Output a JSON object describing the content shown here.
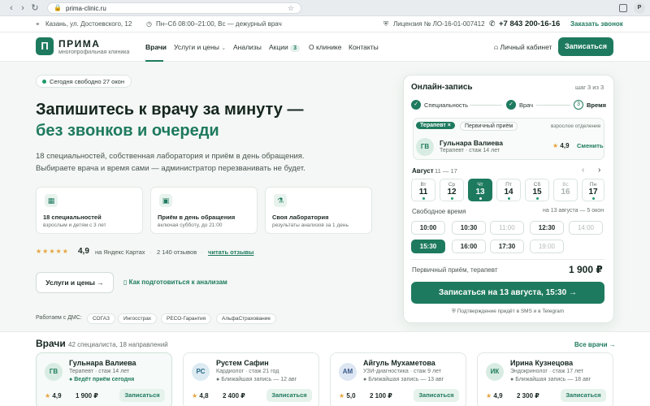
{
  "browser": {
    "url": "prima-clinic.ru",
    "profile": "P"
  },
  "utility": {
    "address": "Казань, ул. Достоевского, 12",
    "hours": "Пн–Сб 08:00–21:00, Вс — дежурный врач",
    "license": "Лицензия № ЛО-16-01-007412",
    "phone": "+7 843 200-16-16",
    "callback": "Заказать звонок"
  },
  "header": {
    "logo_letter": "П",
    "brand": "ПРИМА",
    "tagline": "многопрофильная клиника",
    "nav": {
      "doctors": "Врачи",
      "services": "Услуги и цены",
      "tests": "Анализы",
      "promos": "Акции",
      "promos_count": "3",
      "about": "О клинике",
      "contacts": "Контакты"
    },
    "account": "Личный кабинет",
    "signup": "Записаться"
  },
  "hero": {
    "pill": "Сегодня свободно 27 окон",
    "title_line1": "Запишитесь к врачу за минуту —",
    "title_line2": "без звонков и очереди",
    "lead_line1": "18 специальностей, собственная лаборатория и приём в день обращения.",
    "lead_line2": "Выбираете врача и время сами — администратор перезванивать не будет.",
    "features": [
      {
        "title": "18 специальностей",
        "sub": "взрослым и детям с 3 лет",
        "icon": "grid-icon"
      },
      {
        "title": "Приём в день обращения",
        "sub": "включая субботу, до 21:00",
        "icon": "calendar-icon"
      },
      {
        "title": "Своя лаборатория",
        "sub": "результаты анализов за 1 день",
        "icon": "flask-icon"
      }
    ],
    "rating": "4,9",
    "rating_value": 4.9,
    "rating_source": "на Яндекс Картах",
    "reviews_count": "2 140 отзывов",
    "reviews_link": "читать отзывы",
    "services_btn": "Услуги и цены",
    "prep_link": "Как подготовиться к анализам",
    "dms_label": "Работаем с ДМС:",
    "insurers": [
      "СОГАЗ",
      "Ингосстрах",
      "РЕСО-Гарантия",
      "АльфаСтрахование"
    ]
  },
  "booking": {
    "title": "Онлайн-запись",
    "step_info": "шаг 3 из 3",
    "steps": [
      "Специальность",
      "Врач",
      "Время"
    ],
    "current_step_number": "3",
    "specialty_selected": "Терапевт",
    "visit_type": "Первичный приём",
    "department": "взрослое отделение",
    "doctor": {
      "initials": "ГВ",
      "name": "Гульнара Валиева",
      "meta": "Терапевт · стаж 14 лет",
      "rating": "4,9",
      "change": "Сменить"
    },
    "month": "Август",
    "range": "11 — 17",
    "days": [
      {
        "dow": "Вт",
        "num": "11",
        "free": true
      },
      {
        "dow": "Ср",
        "num": "12",
        "free": true
      },
      {
        "dow": "Чт",
        "num": "13",
        "free": true,
        "selected": true
      },
      {
        "dow": "Пт",
        "num": "14",
        "free": true
      },
      {
        "dow": "Сб",
        "num": "15",
        "free": true
      },
      {
        "dow": "Вс",
        "num": "16",
        "free": false
      },
      {
        "dow": "Пн",
        "num": "17",
        "free": true
      }
    ],
    "free_time_label": "Свободное время",
    "date_label": "на 13 августа — 5 окон",
    "slots": [
      {
        "t": "10:00",
        "state": "free"
      },
      {
        "t": "10:30",
        "state": "free"
      },
      {
        "t": "11:00",
        "state": "busy"
      },
      {
        "t": "12:30",
        "state": "free"
      },
      {
        "t": "14:00",
        "state": "busy"
      },
      {
        "t": "15:30",
        "state": "selected"
      },
      {
        "t": "16:00",
        "state": "free"
      },
      {
        "t": "17:30",
        "state": "free"
      },
      {
        "t": "19:00",
        "state": "busy"
      }
    ],
    "price_label": "Первичный приём, терапевт",
    "price": "1 900 ₽",
    "confirm_btn": "Записаться на 13 августа, 15:30",
    "sms_note": "Подтверждение придёт в SMS и в Telegram"
  },
  "doctors_section": {
    "title": "Врачи",
    "subtitle": "42 специалиста, 18 направлений",
    "all_link": "Все врачи",
    "book": "Записаться",
    "cards": [
      {
        "initials": "ГВ",
        "name": "Гульнара Валиева",
        "spec": "Терапевт · стаж 14 лет",
        "avail": "Ведёт приём сегодня",
        "rating": "4,9",
        "price": "1 900 ₽"
      },
      {
        "initials": "РС",
        "name": "Рустем Сафин",
        "spec": "Кардиолог · стаж 21 год",
        "avail": "Ближайшая запись — 12 авг",
        "rating": "4,8",
        "price": "2 400 ₽"
      },
      {
        "initials": "АМ",
        "name": "Айгуль Мухаметова",
        "spec": "УЗИ-диагностика · стаж 9 лет",
        "avail": "Ближайшая запись — 13 авг",
        "rating": "5,0",
        "price": "2 100 ₽"
      },
      {
        "initials": "ИК",
        "name": "Ирина Кузнецова",
        "spec": "Эндокринолог · стаж 17 лет",
        "avail": "Ближайшая запись — 18 авг",
        "rating": "4,9",
        "price": "2 300 ₽"
      }
    ]
  },
  "colors": {
    "brand": "#1e7a5e",
    "accent_star": "#e8a33a"
  }
}
